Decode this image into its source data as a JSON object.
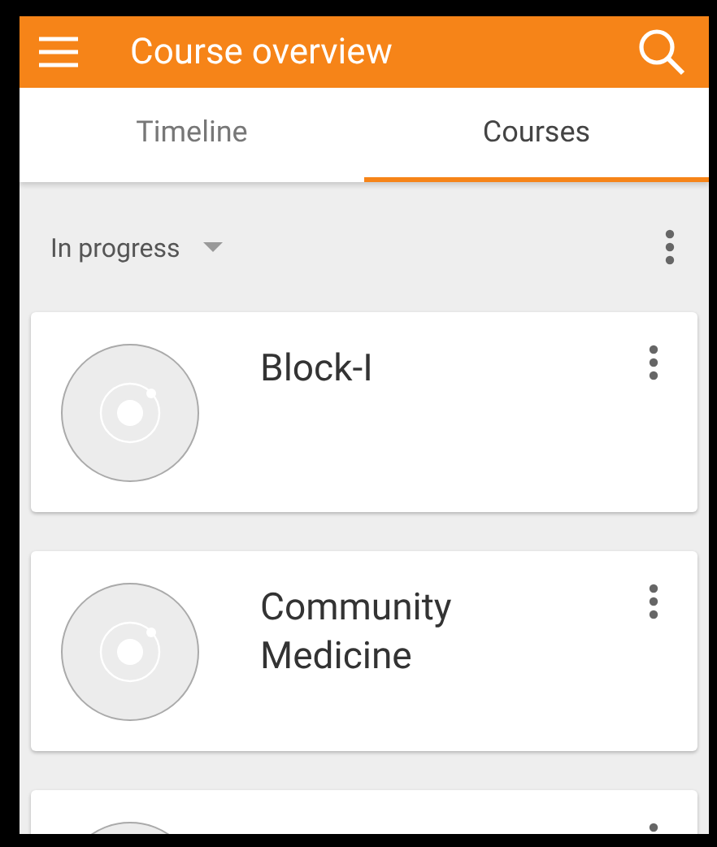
{
  "app_bar": {
    "title": "Course overview"
  },
  "tabs": [
    {
      "label": "Timeline",
      "selected": false
    },
    {
      "label": "Courses",
      "selected": true
    }
  ],
  "filter": {
    "value": "In progress"
  },
  "courses": [
    {
      "title": "Block-I"
    },
    {
      "title": "Community Medicine"
    }
  ],
  "more_cards_below": true
}
